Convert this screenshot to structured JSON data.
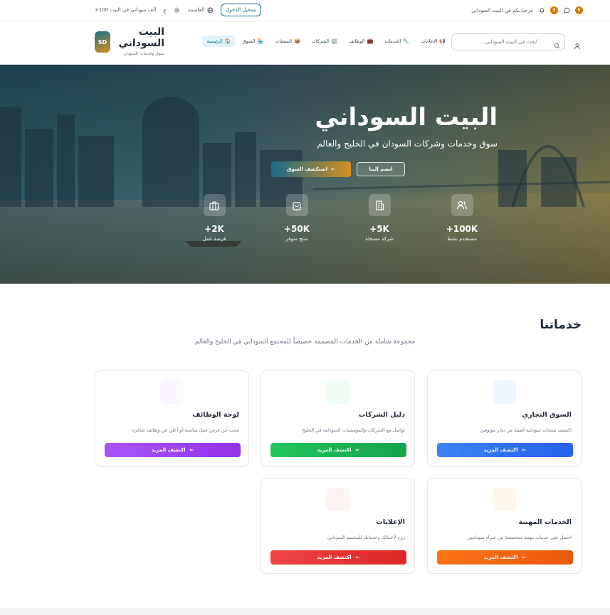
{
  "topbar": {
    "welcome": "مرحبا بكم في البيت السوداني",
    "notif_count": "5",
    "badge_count": "3",
    "community": "+100 ألف سوداني في البيت",
    "lang": "ع",
    "city": "العاصمة",
    "login": "تسجيل الدخول"
  },
  "brand": {
    "badge": "SD",
    "title": "البيت السوداني",
    "subtitle": "سوق وخدمات السودان"
  },
  "nav": {
    "items": [
      {
        "label": "الرئيسية",
        "icon": "🏠"
      },
      {
        "label": "السوق",
        "icon": "🏪"
      },
      {
        "label": "المنتجات",
        "icon": "📦"
      },
      {
        "label": "الشركات",
        "icon": "🏢"
      },
      {
        "label": "الوظائف",
        "icon": "💼"
      },
      {
        "label": "الخدمات",
        "icon": "🔧"
      },
      {
        "label": "الإعلانات",
        "icon": "📢"
      }
    ],
    "search_placeholder": "ابحث في البيت السوداني..."
  },
  "hero": {
    "title": "البيت السوداني",
    "subtitle": "سوق وخدمات وشركات السودان في الخليج والعالم",
    "join": "انضم إلينا",
    "explore": "استكشف السوق",
    "stats": [
      {
        "num": "+100K",
        "label": "مستخدم نشط",
        "icon": "users-icon"
      },
      {
        "num": "+5K",
        "label": "شركة مسجلة",
        "icon": "building-icon"
      },
      {
        "num": "+50K",
        "label": "منتج متوفر",
        "icon": "bag-icon"
      },
      {
        "num": "+2K",
        "label": "فرصة عمل",
        "icon": "briefcase-icon"
      }
    ]
  },
  "services": {
    "title": "خدماتنا",
    "subtitle": "مجموعة شاملة من الخدمات المصممة خصيصاً للمجتمع السوداني في الخليج والعالم",
    "more": "اكتشف المزيد",
    "cards": [
      {
        "title": "السوق التجاري",
        "desc": "اكتشف منتجات سودانية أصيلة من تجار موثوقين",
        "color": "#2563eb"
      },
      {
        "title": "دليل الشركات",
        "desc": "تواصل مع الشركات والمؤسسات السودانية في الخليج",
        "color": "#16a34a"
      },
      {
        "title": "لوحة الوظائف",
        "desc": "ابحث عن فرص عمل مناسبة أو أعلن عن وظائف شاغرة",
        "color": "#9333ea"
      },
      {
        "title": "الخدمات المهنية",
        "desc": "احصل على خدمات مهنية متخصصة من خبراء سودانيين",
        "color": "#ea580c"
      },
      {
        "title": "الإعلانات",
        "desc": "روج لأعمالك وخدماتك للمجتمع السوداني",
        "color": "#dc2626"
      }
    ]
  }
}
